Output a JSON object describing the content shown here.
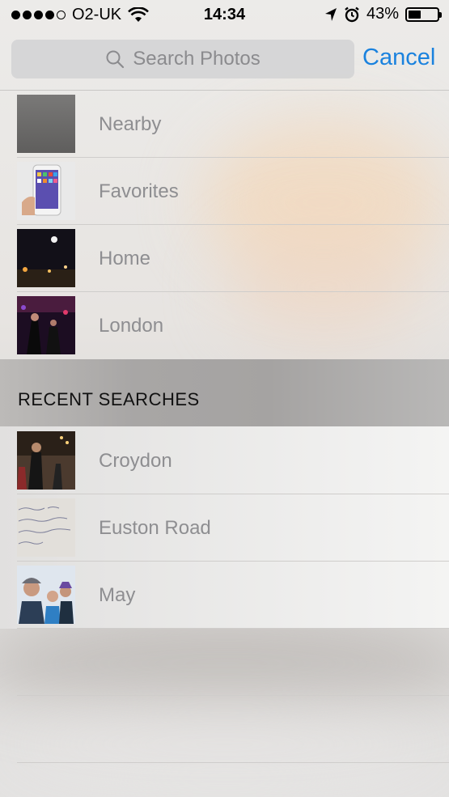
{
  "status": {
    "carrier": "O2-UK",
    "time": "14:34",
    "battery_percent": "43%",
    "battery_level": 0.43,
    "signal_bars": 4
  },
  "search": {
    "placeholder": "Search Photos",
    "cancel_label": "Cancel"
  },
  "places": [
    {
      "label": "Nearby",
      "thumb": "gray"
    },
    {
      "label": "Favorites",
      "thumb": "phone"
    },
    {
      "label": "Home",
      "thumb": "night"
    },
    {
      "label": "London",
      "thumb": "concert"
    }
  ],
  "recent_title": "RECENT SEARCHES",
  "recent": [
    {
      "label": "Croydon",
      "thumb": "street"
    },
    {
      "label": "Euston Road",
      "thumb": "note"
    },
    {
      "label": "May",
      "thumb": "selfie"
    }
  ],
  "colors": {
    "accent": "#1a82de",
    "label": "#8e8e91"
  }
}
